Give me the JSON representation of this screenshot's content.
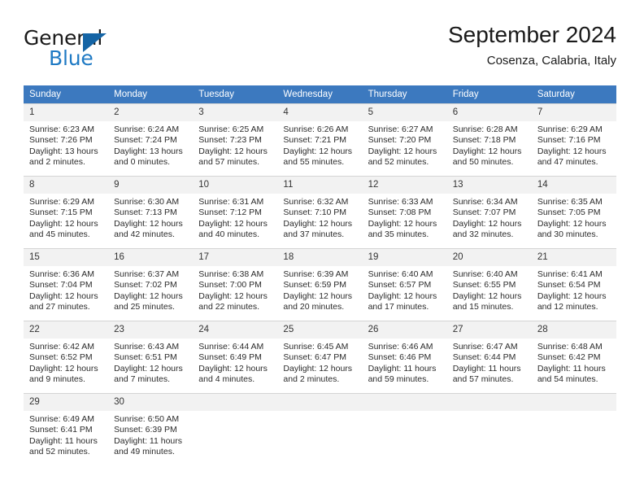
{
  "brand": {
    "name_part1": "General",
    "name_part2": "Blue",
    "triangle_color": "#1464a5",
    "blue_color": "#1f7ac4"
  },
  "header": {
    "title": "September 2024",
    "subtitle": "Cosenza, Calabria, Italy"
  },
  "theme": {
    "header_row_bg": "#3c79bf",
    "daynum_bg": "#f2f2f2",
    "grid_line": "#d4d4d4"
  },
  "calendar": {
    "weekday_headers": [
      "Sunday",
      "Monday",
      "Tuesday",
      "Wednesday",
      "Thursday",
      "Friday",
      "Saturday"
    ],
    "labels": {
      "sunrise": "Sunrise:",
      "sunset": "Sunset:",
      "daylight": "Daylight:"
    },
    "weeks": [
      [
        {
          "day": "1",
          "sunrise": "Sunrise: 6:23 AM",
          "sunset": "Sunset: 7:26 PM",
          "daylight_line1": "Daylight: 13 hours",
          "daylight_line2": "and 2 minutes."
        },
        {
          "day": "2",
          "sunrise": "Sunrise: 6:24 AM",
          "sunset": "Sunset: 7:24 PM",
          "daylight_line1": "Daylight: 13 hours",
          "daylight_line2": "and 0 minutes."
        },
        {
          "day": "3",
          "sunrise": "Sunrise: 6:25 AM",
          "sunset": "Sunset: 7:23 PM",
          "daylight_line1": "Daylight: 12 hours",
          "daylight_line2": "and 57 minutes."
        },
        {
          "day": "4",
          "sunrise": "Sunrise: 6:26 AM",
          "sunset": "Sunset: 7:21 PM",
          "daylight_line1": "Daylight: 12 hours",
          "daylight_line2": "and 55 minutes."
        },
        {
          "day": "5",
          "sunrise": "Sunrise: 6:27 AM",
          "sunset": "Sunset: 7:20 PM",
          "daylight_line1": "Daylight: 12 hours",
          "daylight_line2": "and 52 minutes."
        },
        {
          "day": "6",
          "sunrise": "Sunrise: 6:28 AM",
          "sunset": "Sunset: 7:18 PM",
          "daylight_line1": "Daylight: 12 hours",
          "daylight_line2": "and 50 minutes."
        },
        {
          "day": "7",
          "sunrise": "Sunrise: 6:29 AM",
          "sunset": "Sunset: 7:16 PM",
          "daylight_line1": "Daylight: 12 hours",
          "daylight_line2": "and 47 minutes."
        }
      ],
      [
        {
          "day": "8",
          "sunrise": "Sunrise: 6:29 AM",
          "sunset": "Sunset: 7:15 PM",
          "daylight_line1": "Daylight: 12 hours",
          "daylight_line2": "and 45 minutes."
        },
        {
          "day": "9",
          "sunrise": "Sunrise: 6:30 AM",
          "sunset": "Sunset: 7:13 PM",
          "daylight_line1": "Daylight: 12 hours",
          "daylight_line2": "and 42 minutes."
        },
        {
          "day": "10",
          "sunrise": "Sunrise: 6:31 AM",
          "sunset": "Sunset: 7:12 PM",
          "daylight_line1": "Daylight: 12 hours",
          "daylight_line2": "and 40 minutes."
        },
        {
          "day": "11",
          "sunrise": "Sunrise: 6:32 AM",
          "sunset": "Sunset: 7:10 PM",
          "daylight_line1": "Daylight: 12 hours",
          "daylight_line2": "and 37 minutes."
        },
        {
          "day": "12",
          "sunrise": "Sunrise: 6:33 AM",
          "sunset": "Sunset: 7:08 PM",
          "daylight_line1": "Daylight: 12 hours",
          "daylight_line2": "and 35 minutes."
        },
        {
          "day": "13",
          "sunrise": "Sunrise: 6:34 AM",
          "sunset": "Sunset: 7:07 PM",
          "daylight_line1": "Daylight: 12 hours",
          "daylight_line2": "and 32 minutes."
        },
        {
          "day": "14",
          "sunrise": "Sunrise: 6:35 AM",
          "sunset": "Sunset: 7:05 PM",
          "daylight_line1": "Daylight: 12 hours",
          "daylight_line2": "and 30 minutes."
        }
      ],
      [
        {
          "day": "15",
          "sunrise": "Sunrise: 6:36 AM",
          "sunset": "Sunset: 7:04 PM",
          "daylight_line1": "Daylight: 12 hours",
          "daylight_line2": "and 27 minutes."
        },
        {
          "day": "16",
          "sunrise": "Sunrise: 6:37 AM",
          "sunset": "Sunset: 7:02 PM",
          "daylight_line1": "Daylight: 12 hours",
          "daylight_line2": "and 25 minutes."
        },
        {
          "day": "17",
          "sunrise": "Sunrise: 6:38 AM",
          "sunset": "Sunset: 7:00 PM",
          "daylight_line1": "Daylight: 12 hours",
          "daylight_line2": "and 22 minutes."
        },
        {
          "day": "18",
          "sunrise": "Sunrise: 6:39 AM",
          "sunset": "Sunset: 6:59 PM",
          "daylight_line1": "Daylight: 12 hours",
          "daylight_line2": "and 20 minutes."
        },
        {
          "day": "19",
          "sunrise": "Sunrise: 6:40 AM",
          "sunset": "Sunset: 6:57 PM",
          "daylight_line1": "Daylight: 12 hours",
          "daylight_line2": "and 17 minutes."
        },
        {
          "day": "20",
          "sunrise": "Sunrise: 6:40 AM",
          "sunset": "Sunset: 6:55 PM",
          "daylight_line1": "Daylight: 12 hours",
          "daylight_line2": "and 15 minutes."
        },
        {
          "day": "21",
          "sunrise": "Sunrise: 6:41 AM",
          "sunset": "Sunset: 6:54 PM",
          "daylight_line1": "Daylight: 12 hours",
          "daylight_line2": "and 12 minutes."
        }
      ],
      [
        {
          "day": "22",
          "sunrise": "Sunrise: 6:42 AM",
          "sunset": "Sunset: 6:52 PM",
          "daylight_line1": "Daylight: 12 hours",
          "daylight_line2": "and 9 minutes."
        },
        {
          "day": "23",
          "sunrise": "Sunrise: 6:43 AM",
          "sunset": "Sunset: 6:51 PM",
          "daylight_line1": "Daylight: 12 hours",
          "daylight_line2": "and 7 minutes."
        },
        {
          "day": "24",
          "sunrise": "Sunrise: 6:44 AM",
          "sunset": "Sunset: 6:49 PM",
          "daylight_line1": "Daylight: 12 hours",
          "daylight_line2": "and 4 minutes."
        },
        {
          "day": "25",
          "sunrise": "Sunrise: 6:45 AM",
          "sunset": "Sunset: 6:47 PM",
          "daylight_line1": "Daylight: 12 hours",
          "daylight_line2": "and 2 minutes."
        },
        {
          "day": "26",
          "sunrise": "Sunrise: 6:46 AM",
          "sunset": "Sunset: 6:46 PM",
          "daylight_line1": "Daylight: 11 hours",
          "daylight_line2": "and 59 minutes."
        },
        {
          "day": "27",
          "sunrise": "Sunrise: 6:47 AM",
          "sunset": "Sunset: 6:44 PM",
          "daylight_line1": "Daylight: 11 hours",
          "daylight_line2": "and 57 minutes."
        },
        {
          "day": "28",
          "sunrise": "Sunrise: 6:48 AM",
          "sunset": "Sunset: 6:42 PM",
          "daylight_line1": "Daylight: 11 hours",
          "daylight_line2": "and 54 minutes."
        }
      ],
      [
        {
          "day": "29",
          "sunrise": "Sunrise: 6:49 AM",
          "sunset": "Sunset: 6:41 PM",
          "daylight_line1": "Daylight: 11 hours",
          "daylight_line2": "and 52 minutes."
        },
        {
          "day": "30",
          "sunrise": "Sunrise: 6:50 AM",
          "sunset": "Sunset: 6:39 PM",
          "daylight_line1": "Daylight: 11 hours",
          "daylight_line2": "and 49 minutes."
        },
        {
          "day": "",
          "sunrise": "",
          "sunset": "",
          "daylight_line1": "",
          "daylight_line2": ""
        },
        {
          "day": "",
          "sunrise": "",
          "sunset": "",
          "daylight_line1": "",
          "daylight_line2": ""
        },
        {
          "day": "",
          "sunrise": "",
          "sunset": "",
          "daylight_line1": "",
          "daylight_line2": ""
        },
        {
          "day": "",
          "sunrise": "",
          "sunset": "",
          "daylight_line1": "",
          "daylight_line2": ""
        },
        {
          "day": "",
          "sunrise": "",
          "sunset": "",
          "daylight_line1": "",
          "daylight_line2": ""
        }
      ]
    ]
  }
}
